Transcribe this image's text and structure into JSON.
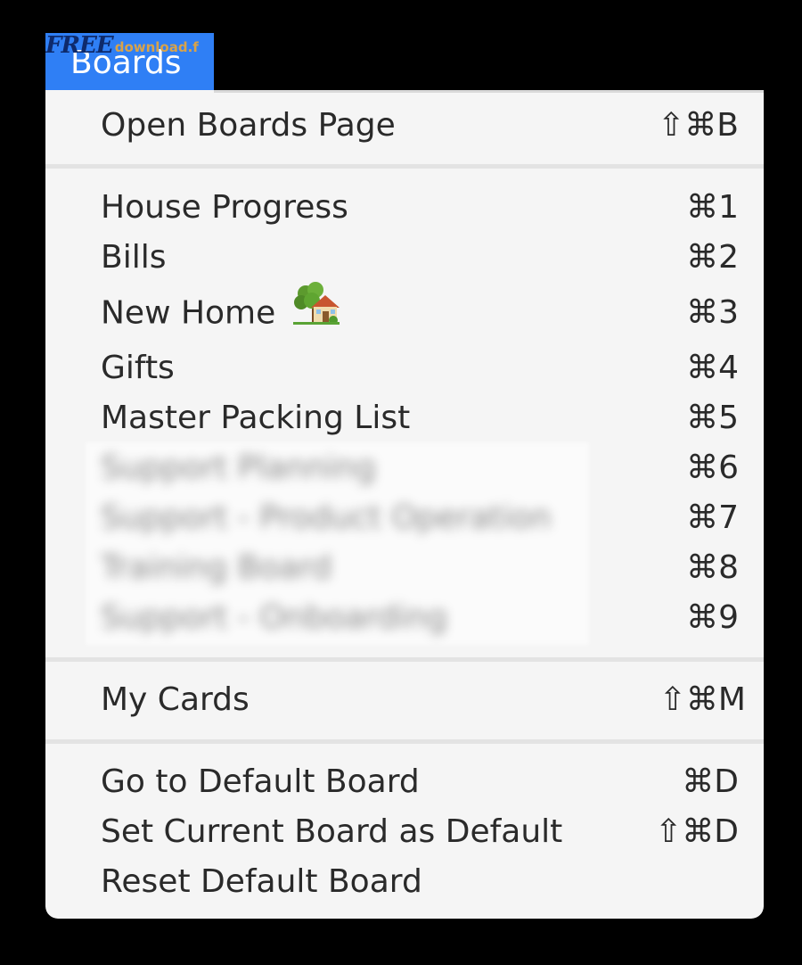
{
  "menubar": {
    "title": "Boards",
    "watermark_big": "FREE",
    "watermark_small": "download.f"
  },
  "menu": {
    "items": [
      {
        "label": "Open Boards Page",
        "shortcut": "⇧⌘B"
      },
      {
        "label": "House Progress",
        "shortcut": "⌘1"
      },
      {
        "label": "Bills",
        "shortcut": "⌘2"
      },
      {
        "label": "New Home",
        "shortcut": "⌘3",
        "icon": "house-with-garden-emoji"
      },
      {
        "label": "Gifts",
        "shortcut": "⌘4"
      },
      {
        "label": "Master Packing List",
        "shortcut": "⌘5"
      },
      {
        "label": "Support Planning",
        "shortcut": "⌘6",
        "obscured": true
      },
      {
        "label": "Support - Product Operation",
        "shortcut": "⌘7",
        "obscured": true
      },
      {
        "label": "Training Board",
        "shortcut": "⌘8",
        "obscured": true
      },
      {
        "label": "Support - Onboarding",
        "shortcut": "⌘9",
        "obscured": true
      },
      {
        "label": "My Cards",
        "shortcut": "⇧⌘M"
      },
      {
        "label": "Go to Default Board",
        "shortcut": "⌘D"
      },
      {
        "label": "Set Current Board as Default",
        "shortcut": "⇧⌘D"
      },
      {
        "label": "Reset Default Board",
        "shortcut": ""
      }
    ]
  },
  "colors": {
    "highlight": "#2f7ff5",
    "menu_bg": "#f5f5f5",
    "separator": "#e3e3e3",
    "text": "#2a2a2a"
  }
}
